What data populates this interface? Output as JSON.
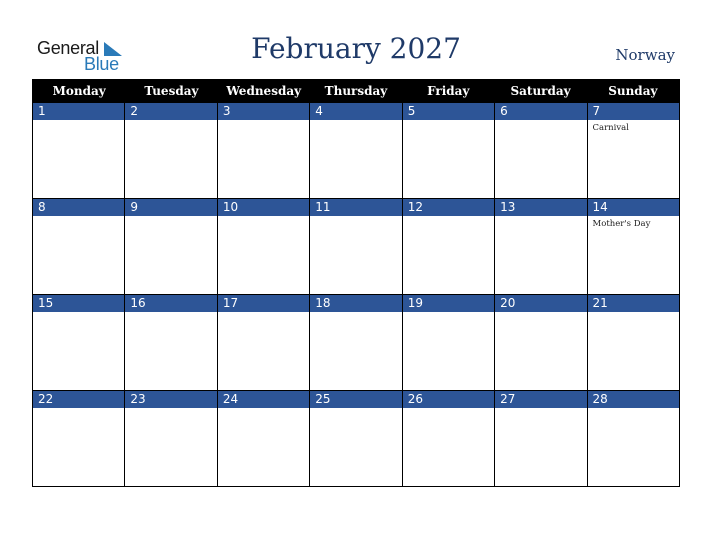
{
  "logo": {
    "general": "General",
    "blue": "Blue"
  },
  "title": "February 2027",
  "country": "Norway",
  "weekdays": [
    "Monday",
    "Tuesday",
    "Wednesday",
    "Thursday",
    "Friday",
    "Saturday",
    "Sunday"
  ],
  "weeks": [
    [
      {
        "day": "1",
        "event": ""
      },
      {
        "day": "2",
        "event": ""
      },
      {
        "day": "3",
        "event": ""
      },
      {
        "day": "4",
        "event": ""
      },
      {
        "day": "5",
        "event": ""
      },
      {
        "day": "6",
        "event": ""
      },
      {
        "day": "7",
        "event": "Carnival"
      }
    ],
    [
      {
        "day": "8",
        "event": ""
      },
      {
        "day": "9",
        "event": ""
      },
      {
        "day": "10",
        "event": ""
      },
      {
        "day": "11",
        "event": ""
      },
      {
        "day": "12",
        "event": ""
      },
      {
        "day": "13",
        "event": ""
      },
      {
        "day": "14",
        "event": "Mother's Day"
      }
    ],
    [
      {
        "day": "15",
        "event": ""
      },
      {
        "day": "16",
        "event": ""
      },
      {
        "day": "17",
        "event": ""
      },
      {
        "day": "18",
        "event": ""
      },
      {
        "day": "19",
        "event": ""
      },
      {
        "day": "20",
        "event": ""
      },
      {
        "day": "21",
        "event": ""
      }
    ],
    [
      {
        "day": "22",
        "event": ""
      },
      {
        "day": "23",
        "event": ""
      },
      {
        "day": "24",
        "event": ""
      },
      {
        "day": "25",
        "event": ""
      },
      {
        "day": "26",
        "event": ""
      },
      {
        "day": "27",
        "event": ""
      },
      {
        "day": "28",
        "event": ""
      }
    ]
  ],
  "colors": {
    "header_bg": "#000000",
    "date_bar": "#2d5597",
    "title": "#1f3a68",
    "logo_blue": "#2a7ab8"
  }
}
